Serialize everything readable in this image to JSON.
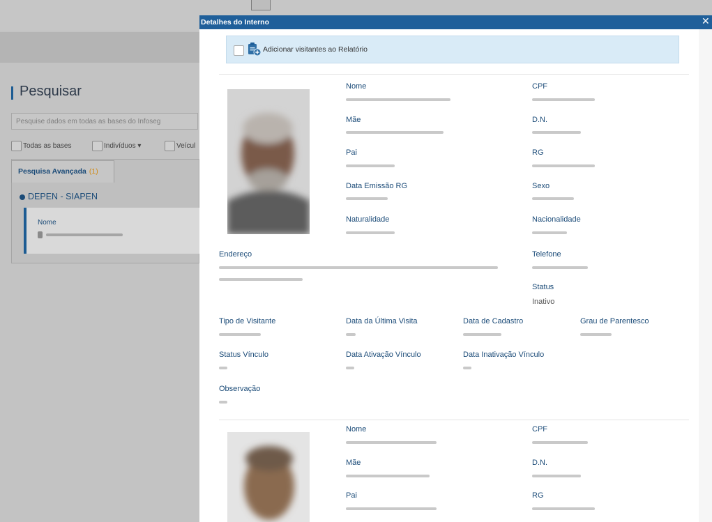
{
  "background": {
    "search_title": "Pesquisar",
    "search_placeholder": "Pesquise dados em todas as bases do Infoseg",
    "checkboxes": [
      "Todas as bases",
      "Indivíduos",
      "Veícul"
    ],
    "advanced_tab_label": "Pesquisa Avançada",
    "advanced_tab_count": "(1)",
    "source_label": "DEPEN - SIAPEN",
    "field_label": "Nome"
  },
  "modal": {
    "title": "Detalhes do Interno",
    "close_icon": "close-icon",
    "add_visitors_label": "Adicionar visitantes ao Relatório"
  },
  "labels": {
    "nome": "Nome",
    "cpf": "CPF",
    "mae": "Mãe",
    "dn": "D.N.",
    "pai": "Pai",
    "rg": "RG",
    "data_emissao_rg": "Data Emissão RG",
    "sexo": "Sexo",
    "naturalidade": "Naturalidade",
    "nacionalidade": "Nacionalidade",
    "endereco": "Endereço",
    "telefone": "Telefone",
    "status": "Status",
    "tipo_visitante": "Tipo de Visitante",
    "data_ultima_visita": "Data da Última Visita",
    "data_cadastro": "Data de Cadastro",
    "grau_parentesco": "Grau de Parentesco",
    "status_vinculo": "Status Vínculo",
    "data_ativacao_vinculo": "Data Ativação Vínculo",
    "data_inativacao_vinculo": "Data Inativação Vínculo",
    "observacao": "Observação"
  },
  "visitor1": {
    "status_value": "Inativo"
  },
  "colors": {
    "header": "#1f5f9a",
    "label": "#1b4b78",
    "info_bar": "#d9ebf7",
    "badge_count": "#d08a15"
  }
}
